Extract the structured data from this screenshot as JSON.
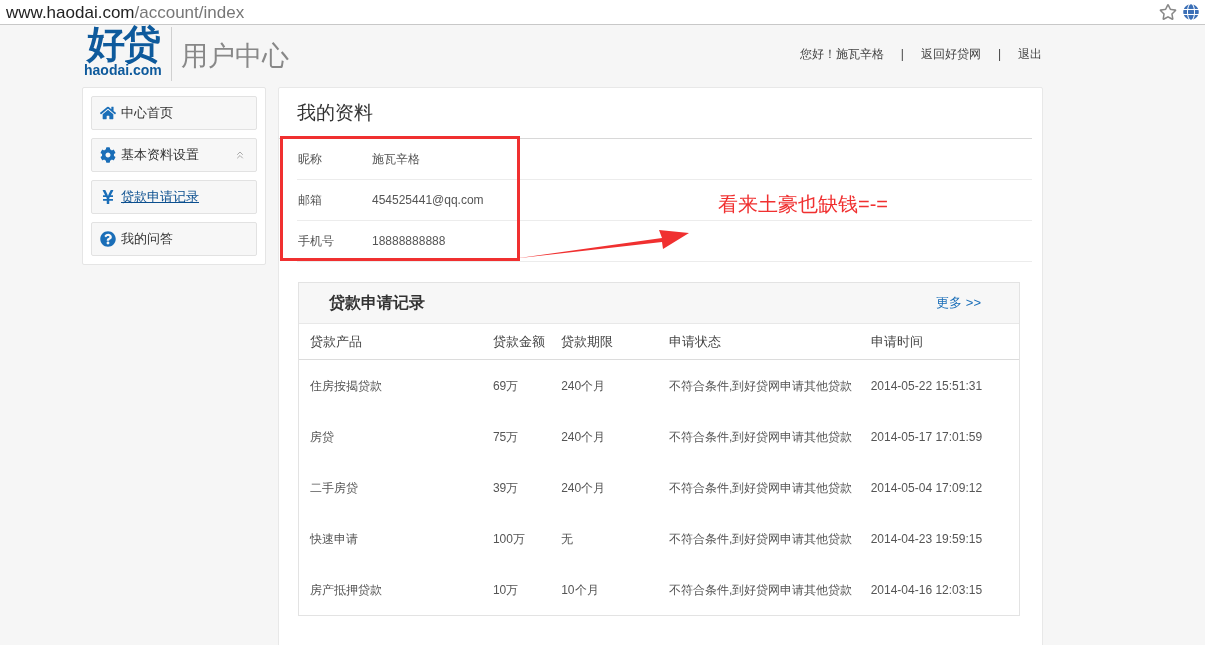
{
  "address_bar": {
    "host": "www.haodai.com",
    "path": "/account/index"
  },
  "header": {
    "logo_mark": "好贷",
    "logo_domain": "haodai.com",
    "title": "用户中心",
    "greeting": "您好！施瓦辛格",
    "separator": "|",
    "links": [
      "返回好贷网",
      "退出"
    ]
  },
  "sidebar": {
    "items": [
      {
        "kind": "home",
        "label": "中心首页",
        "selected": false,
        "toggle": false
      },
      {
        "kind": "settings",
        "label": "基本资料设置",
        "selected": false,
        "toggle": true
      },
      {
        "kind": "yen",
        "label": "贷款申请记录",
        "selected": true,
        "toggle": false
      },
      {
        "kind": "help",
        "label": "我的问答",
        "selected": false,
        "toggle": false
      }
    ]
  },
  "profile": {
    "title": "我的资料",
    "fields": [
      {
        "label": "昵称",
        "value": "施瓦辛格"
      },
      {
        "label": "邮箱",
        "value": "454525441@qq.com"
      },
      {
        "label": "手机号",
        "value": "18888888888"
      }
    ]
  },
  "annotation": {
    "text": "看来土豪也缺钱=-="
  },
  "loans": {
    "title": "贷款申请记录",
    "more": "更多 >>",
    "columns": [
      "贷款产品",
      "贷款金额",
      "贷款期限",
      "申请状态",
      "申请时间"
    ],
    "rows": [
      [
        "住房按揭贷款",
        "69万",
        "240个月",
        "不符合条件,到好贷网申请其他贷款",
        "2014-05-22 15:51:31"
      ],
      [
        "房贷",
        "75万",
        "240个月",
        "不符合条件,到好贷网申请其他贷款",
        "2014-05-17 17:01:59"
      ],
      [
        "二手房贷",
        "39万",
        "240个月",
        "不符合条件,到好贷网申请其他贷款",
        "2014-05-04 17:09:12"
      ],
      [
        "快速申请",
        "100万",
        "无",
        "不符合条件,到好贷网申请其他贷款",
        "2014-04-23 19:59:15"
      ],
      [
        "房产抵押贷款",
        "10万",
        "10个月",
        "不符合条件,到好贷网申请其他贷款",
        "2014-04-16 12:03:15"
      ]
    ]
  }
}
